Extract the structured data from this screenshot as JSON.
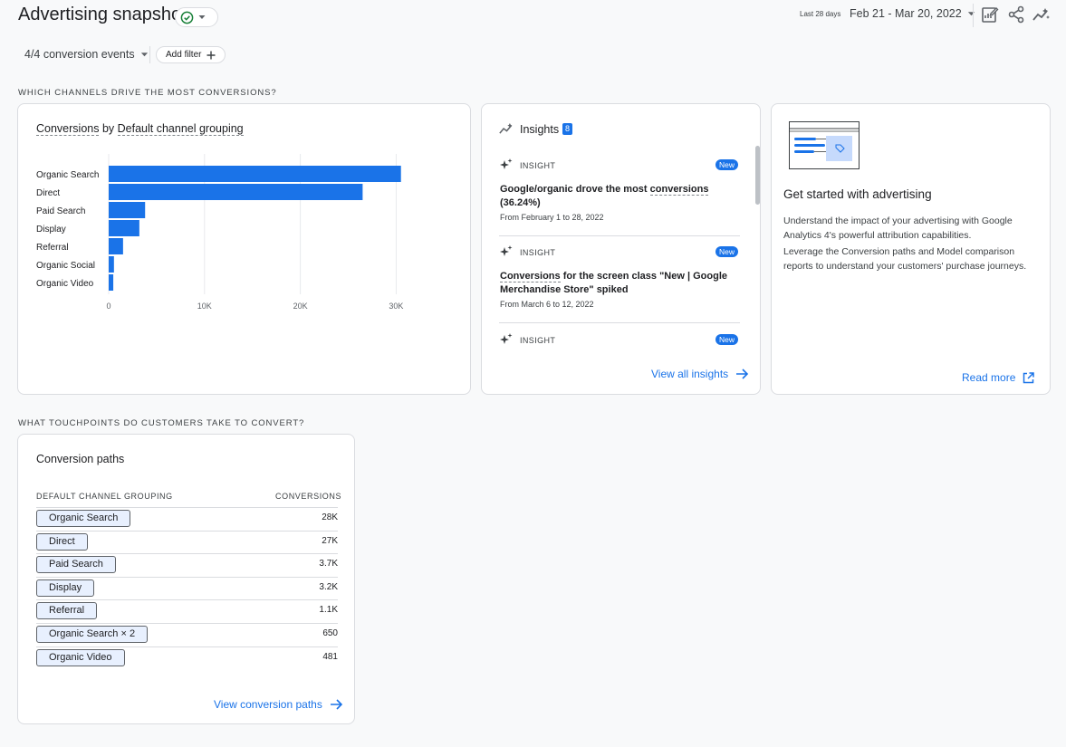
{
  "header": {
    "title": "Advertising snapshot",
    "date_small": "Last 28 days",
    "date_range": "Feb 21 - Mar 20, 2022"
  },
  "filters": {
    "conversion_events": "4/4 conversion events",
    "add_filter": "Add filter"
  },
  "sections": {
    "channels": "WHICH CHANNELS DRIVE THE MOST CONVERSIONS?",
    "touchpoints": "WHAT TOUCHPOINTS DO CUSTOMERS TAKE TO CONVERT?"
  },
  "chart_card": {
    "title_part1": "Conversions",
    "title_by": " by ",
    "title_part2": "Default channel grouping"
  },
  "chart_data": {
    "type": "bar",
    "orientation": "horizontal",
    "categories": [
      "Organic Search",
      "Direct",
      "Paid Search",
      "Display",
      "Referral",
      "Organic Social",
      "Organic Video"
    ],
    "values": [
      30500,
      26500,
      3800,
      3200,
      1500,
      550,
      480
    ],
    "xlim": [
      0,
      31000
    ],
    "xticks": [
      0,
      10000,
      20000,
      30000
    ],
    "xtick_labels": [
      "0",
      "10K",
      "20K",
      "30K"
    ],
    "grid": true,
    "bar_color": "#1a73e8"
  },
  "insights": {
    "title": "Insights",
    "count": "8",
    "items": [
      {
        "tag": "INSIGHT",
        "badge": "New",
        "text_a": "Google/organic drove the most ",
        "text_b": "conversions",
        "text_c": "(36.24%)",
        "date": "From February 1 to 28, 2022"
      },
      {
        "tag": "INSIGHT",
        "badge": "New",
        "text_a": "Conversions",
        "text_b": " for the screen class \"New | Google",
        "text_c": "Merchandise Store\" spiked",
        "date": "From March 6 to 12, 2022"
      },
      {
        "tag": "INSIGHT",
        "badge": "New"
      }
    ],
    "view_all": "View all insights"
  },
  "advertising": {
    "title": "Get started with advertising",
    "para1_line1": "Understand the impact of your advertising with Google",
    "para1_line2": "Analytics 4's powerful attribution capabilities.",
    "para2_line1": "Leverage the Conversion paths and Model comparison",
    "para2_line2": "reports to understand your customers' purchase journeys.",
    "read_more": "Read more"
  },
  "paths": {
    "title": "Conversion paths",
    "col1": "DEFAULT CHANNEL GROUPING",
    "col2": "CONVERSIONS",
    "rows": [
      {
        "label": "Organic Search",
        "value": "28K"
      },
      {
        "label": "Direct",
        "value": "27K"
      },
      {
        "label": "Paid Search",
        "value": "3.7K"
      },
      {
        "label": "Display",
        "value": "3.2K"
      },
      {
        "label": "Referral",
        "value": "1.1K"
      },
      {
        "label": "Organic Search",
        "suffix": " × 2",
        "value": "650"
      },
      {
        "label": "Organic Video",
        "value": "481"
      }
    ],
    "view_link": "View conversion paths"
  },
  "colors": {
    "accent": "#1a73e8",
    "success": "#188038",
    "chip_bg": "#e8f0fe"
  }
}
